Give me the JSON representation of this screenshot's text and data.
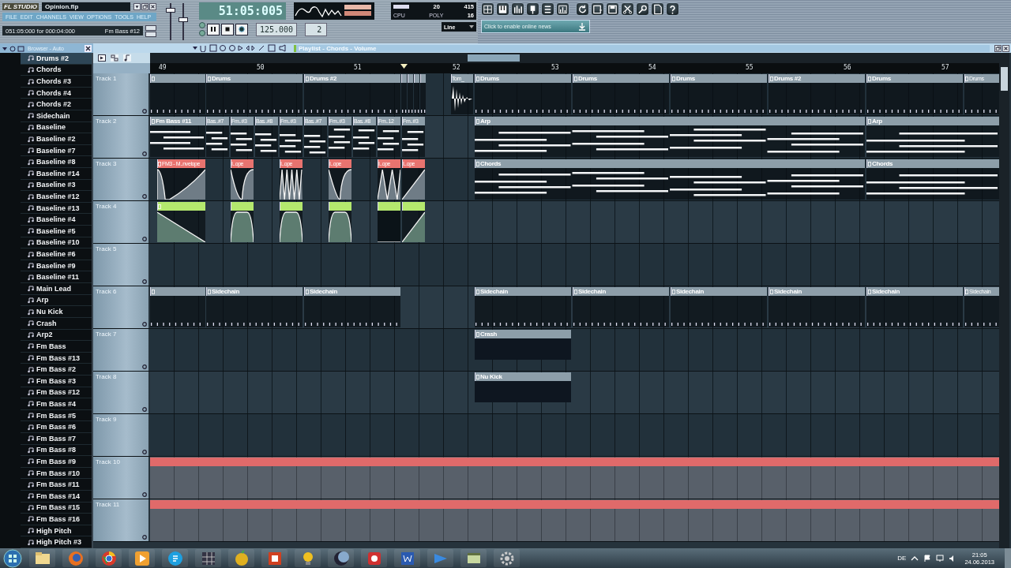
{
  "header": {
    "logo": "FL STUDIO",
    "project": "Opinion.flp",
    "menu": [
      "FILE",
      "EDIT",
      "CHANNELS",
      "VIEW",
      "OPTIONS",
      "TOOLS",
      "HELP"
    ],
    "hint": "051:05:000 for 000:04:000",
    "hint_channel": "Fm Bass #12",
    "sliders": [
      {
        "level": 0.8
      },
      {
        "level": 0.55
      }
    ],
    "song_time": "51:05:005",
    "tempo": "125.000",
    "pattern": "2",
    "cpu_value": "20",
    "poly_value": "415",
    "ram_value": "16",
    "cpu_label": "CPU",
    "poly_label": "POLY",
    "audio_input": "Line",
    "news": "Click to enable online news"
  },
  "browser": {
    "title": "Browser - Auto",
    "items": [
      {
        "label": "Drums #2",
        "selected": true
      },
      {
        "label": "Chords",
        "selected": false
      },
      {
        "label": "Chords #3",
        "selected": false
      },
      {
        "label": "Chords #4",
        "selected": false
      },
      {
        "label": "Chords #2",
        "selected": false
      },
      {
        "label": "Sidechain",
        "selected": false
      },
      {
        "label": "Baseline",
        "selected": false
      },
      {
        "label": "Baseline #2",
        "selected": false
      },
      {
        "label": "Baseline #7",
        "selected": false
      },
      {
        "label": "Baseline #8",
        "selected": false
      },
      {
        "label": "Baseline #14",
        "selected": false
      },
      {
        "label": "Baseline #3",
        "selected": false
      },
      {
        "label": "Baseline #12",
        "selected": false
      },
      {
        "label": "Baseline #13",
        "selected": false
      },
      {
        "label": "Baseline #4",
        "selected": false
      },
      {
        "label": "Baseline #5",
        "selected": false
      },
      {
        "label": "Baseline #10",
        "selected": false
      },
      {
        "label": "Baseline #6",
        "selected": false
      },
      {
        "label": "Baseline #9",
        "selected": false
      },
      {
        "label": "Baseline #11",
        "selected": false
      },
      {
        "label": "Main Lead",
        "selected": false
      },
      {
        "label": "Arp",
        "selected": false
      },
      {
        "label": "Nu Kick",
        "selected": false
      },
      {
        "label": "Crash",
        "selected": false
      },
      {
        "label": "Arp2",
        "selected": false
      },
      {
        "label": "Fm Bass",
        "selected": false
      },
      {
        "label": "Fm Bass #13",
        "selected": false
      },
      {
        "label": "Fm Bass #2",
        "selected": false
      },
      {
        "label": "Fm Bass #3",
        "selected": false
      },
      {
        "label": "Fm Bass #12",
        "selected": false
      },
      {
        "label": "Fm Bass #4",
        "selected": false
      },
      {
        "label": "Fm Bass #5",
        "selected": false
      },
      {
        "label": "Fm Bass #6",
        "selected": false
      },
      {
        "label": "Fm Bass #7",
        "selected": false
      },
      {
        "label": "Fm Bass #8",
        "selected": false
      },
      {
        "label": "Fm Bass #9",
        "selected": false
      },
      {
        "label": "Fm Bass #10",
        "selected": false
      },
      {
        "label": "Fm Bass #11",
        "selected": false
      },
      {
        "label": "Fm Bass #14",
        "selected": false
      },
      {
        "label": "Fm Bass #15",
        "selected": false
      },
      {
        "label": "Fm Bass #16",
        "selected": false
      },
      {
        "label": "High Pitch",
        "selected": false
      },
      {
        "label": "High Pitch #3",
        "selected": false
      }
    ]
  },
  "playlist": {
    "title": "Playlist - Chords - Volume",
    "ruler": [
      "49",
      "50",
      "51",
      "52",
      "53",
      "54",
      "55",
      "56",
      "57"
    ],
    "tracks": [
      {
        "name": "Track 1",
        "clips": [
          {
            "kind": "drums"
          },
          {
            "kind": "drums",
            "label": "Drums"
          },
          {
            "kind": "drums",
            "label": "Drums #2"
          },
          {
            "kind": "drums"
          },
          {
            "kind": "drums"
          },
          {
            "kind": "drums"
          },
          {
            "kind": "drums"
          },
          {
            "kind": "audio",
            "label": "Tom_"
          },
          {
            "kind": "drums",
            "label": "Drums"
          },
          {
            "kind": "drums",
            "label": "Drums"
          },
          {
            "kind": "drums",
            "label": "Drums"
          },
          {
            "kind": "drums",
            "label": "Drums #2"
          },
          {
            "kind": "drums",
            "label": "Drums"
          },
          {
            "kind": "drums",
            "label": "Drums"
          }
        ]
      },
      {
        "name": "Track 2",
        "clips": [
          {
            "kind": "notes",
            "label": "Fm Bass #11"
          },
          {
            "kind": "notes",
            "label": "Bas..#7"
          },
          {
            "kind": "notes",
            "label": "Fm..#3"
          },
          {
            "kind": "notes",
            "label": "Bas..#8"
          },
          {
            "kind": "notes",
            "label": "Fm..#3"
          },
          {
            "kind": "notes",
            "label": "Bas..#7"
          },
          {
            "kind": "notes",
            "label": "Fm..#3"
          },
          {
            "kind": "notes",
            "label": "Bas..#8"
          },
          {
            "kind": "notes",
            "label": "Fm..12"
          },
          {
            "kind": "notes",
            "label": "Fm..#3"
          },
          {
            "kind": "notes",
            "label": "Arp"
          },
          {
            "kind": "notes",
            "label": "Arp"
          }
        ]
      },
      {
        "name": "Track 3",
        "clips": [
          {
            "kind": "automation",
            "label": "FM3 - M..nvelope",
            "color": "#e8736f"
          },
          {
            "kind": "automation",
            "label": "I..ope",
            "color": "#e8736f"
          },
          {
            "kind": "automation",
            "label": "I..ope",
            "color": "#e8736f"
          },
          {
            "kind": "automation",
            "label": "I..ope",
            "color": "#e8736f"
          },
          {
            "kind": "automation",
            "label": "I..ope",
            "color": "#e8736f"
          },
          {
            "kind": "automation",
            "label": "I..ope",
            "color": "#e8736f"
          },
          {
            "kind": "notes",
            "label": "Chords"
          },
          {
            "kind": "notes",
            "label": "Chords"
          }
        ]
      },
      {
        "name": "Track 4",
        "clips": [
          {
            "kind": "automation",
            "color": "#b4e86e"
          },
          {
            "kind": "automation",
            "color": "#b4e86e"
          },
          {
            "kind": "automation",
            "color": "#b4e86e"
          },
          {
            "kind": "automation",
            "color": "#b4e86e"
          },
          {
            "kind": "automation",
            "color": "#b4e86e"
          },
          {
            "kind": "automation",
            "color": "#b4e86e"
          }
        ]
      },
      {
        "name": "Track 5"
      },
      {
        "name": "Track 6",
        "clips": [
          {
            "kind": "drums"
          },
          {
            "kind": "drums",
            "label": "Sidechain"
          },
          {
            "kind": "drums",
            "label": "Sidechain"
          },
          {
            "kind": "drums",
            "label": "Sidechain"
          },
          {
            "kind": "drums",
            "label": "Sidechain"
          },
          {
            "kind": "drums",
            "label": "Sidechain"
          },
          {
            "kind": "drums",
            "label": "Sidechain"
          },
          {
            "kind": "drums",
            "label": "Sidechain"
          },
          {
            "kind": "drums",
            "label": "Sidechain"
          }
        ]
      },
      {
        "name": "Track 7",
        "clips": [
          {
            "kind": "empty",
            "label": "Crash"
          }
        ]
      },
      {
        "name": "Track 8",
        "clips": [
          {
            "kind": "empty",
            "label": "Nu Kick"
          }
        ]
      },
      {
        "name": "Track 9"
      },
      {
        "name": "Track 10",
        "clips": [
          {
            "kind": "strip",
            "color": "#e06a6a"
          }
        ]
      },
      {
        "name": "Track 11",
        "clips": [
          {
            "kind": "strip",
            "color": "#e06a6a"
          }
        ]
      }
    ]
  },
  "taskbar": {
    "language": "DE",
    "time": "21:05",
    "date": "24.06.2013"
  }
}
